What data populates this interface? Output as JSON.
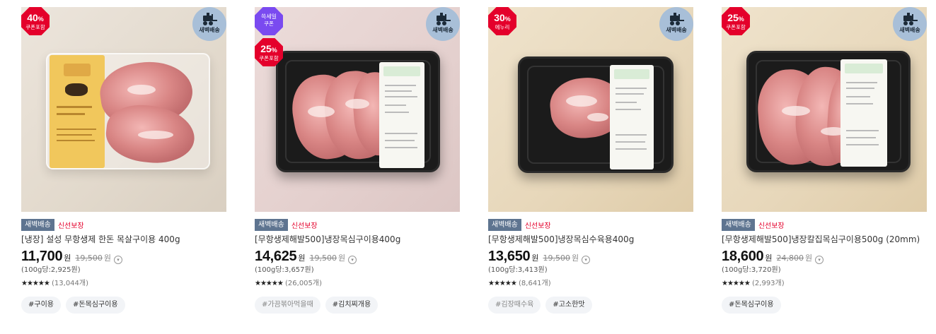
{
  "products": [
    {
      "badge": {
        "top": "40%",
        "bottom": "쿠폰포함",
        "color": "#e4002b"
      },
      "dawn_badge": "새벽배송",
      "delivery_tag": "새벽배송",
      "fresh_tag": "신선보장",
      "title": "[냉장] 설성 무항생제 한돈 목살구이용 400g",
      "price": "11,700",
      "price_unit": "원",
      "original_price": "19,500",
      "original_unit": "원",
      "unit_price": "(100g당:2,925원)",
      "stars": "★★★★★",
      "reviews": "(13,044개)",
      "hashtags": [
        "#구이용",
        "#돈목심구이용"
      ]
    },
    {
      "badge_secondary": {
        "top": "쓱세일",
        "bottom": "쿠폰",
        "color": "#7a4af0"
      },
      "badge": {
        "top": "25%",
        "bottom": "쿠폰포함",
        "color": "#e4002b"
      },
      "dawn_badge": "새벽배송",
      "delivery_tag": "새벽배송",
      "fresh_tag": "신선보장",
      "title": "[무항생제해발500]냉장목심구이용400g",
      "price": "14,625",
      "price_unit": "원",
      "original_price": "19,500",
      "original_unit": "원",
      "unit_price": "(100g당:3,657원)",
      "stars": "★★★★★",
      "reviews": "(26,005개)",
      "hashtags": [
        "#가끔볶아먹을때",
        "#김치찌개용"
      ]
    },
    {
      "badge": {
        "top": "30%",
        "bottom": "에누리",
        "color": "#e4002b"
      },
      "dawn_badge": "새벽배송",
      "delivery_tag": "새벽배송",
      "fresh_tag": "신선보장",
      "title": "[무항생제해발500]냉장목심수육용400g",
      "price": "13,650",
      "price_unit": "원",
      "original_price": "19,500",
      "original_unit": "원",
      "unit_price": "(100g당:3,413원)",
      "stars": "★★★★★",
      "reviews": "(8,641개)",
      "hashtags": [
        "#김장때수육",
        "#고소한맛"
      ]
    },
    {
      "badge": {
        "top": "25%",
        "bottom": "쿠폰포함",
        "color": "#e4002b"
      },
      "dawn_badge": "새벽배송",
      "delivery_tag": "새벽배송",
      "fresh_tag": "신선보장",
      "title": "[무항생제해발500]냉장칼집목심구이용500g (20mm)",
      "price": "18,600",
      "price_unit": "원",
      "original_price": "24,800",
      "original_unit": "원",
      "unit_price": "(100g당:3,720원)",
      "stars": "★★★★★",
      "reviews": "(2,993개)",
      "hashtags": [
        "#돈목심구이용"
      ]
    }
  ],
  "icons": {
    "dawn": "truck-icon",
    "info": "info-circle-icon",
    "rating": "star-icon"
  }
}
